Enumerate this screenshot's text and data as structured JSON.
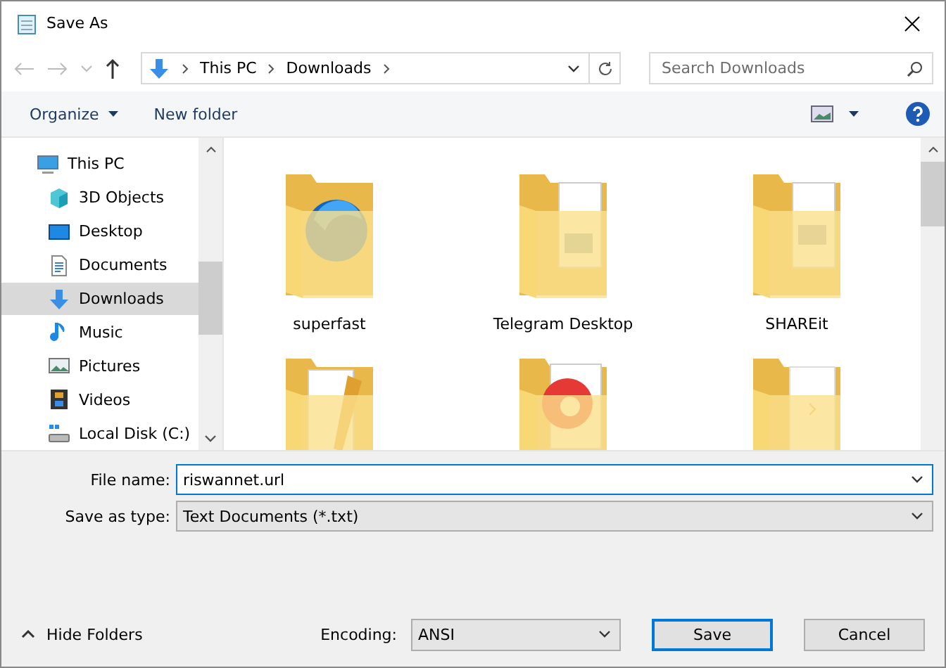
{
  "window": {
    "title": "Save As"
  },
  "address": {
    "segments": [
      "This PC",
      "Downloads"
    ]
  },
  "search": {
    "placeholder": "Search Downloads"
  },
  "toolbar": {
    "buttons": [
      {
        "label": "Organize",
        "kind": "menu"
      },
      {
        "label": "New folder",
        "kind": "plain"
      }
    ]
  },
  "sidebar": {
    "items": [
      {
        "label": "This PC",
        "selected": false,
        "children": [
          {
            "label": "3D Objects",
            "selected": false
          },
          {
            "label": "Desktop",
            "selected": false
          },
          {
            "label": "Documents",
            "selected": false
          },
          {
            "label": "Downloads",
            "selected": true
          },
          {
            "label": "Music",
            "selected": false
          },
          {
            "label": "Pictures",
            "selected": false
          },
          {
            "label": "Videos",
            "selected": false
          },
          {
            "label": "Local Disk (C:)",
            "selected": false
          }
        ]
      }
    ]
  },
  "files": [
    {
      "name": "superfast"
    },
    {
      "name": "Telegram Desktop"
    },
    {
      "name": "SHAREit"
    }
  ],
  "form": {
    "file_name_label": "File name:",
    "file_name": "riswannet.url",
    "type_label": "Save as type:",
    "type": "Text Documents (*.txt)"
  },
  "footer": {
    "hide_folders": "Hide Folders",
    "encoding_label": "Encoding:",
    "encoding": "ANSI",
    "save": "Save",
    "cancel": "Cancel"
  }
}
